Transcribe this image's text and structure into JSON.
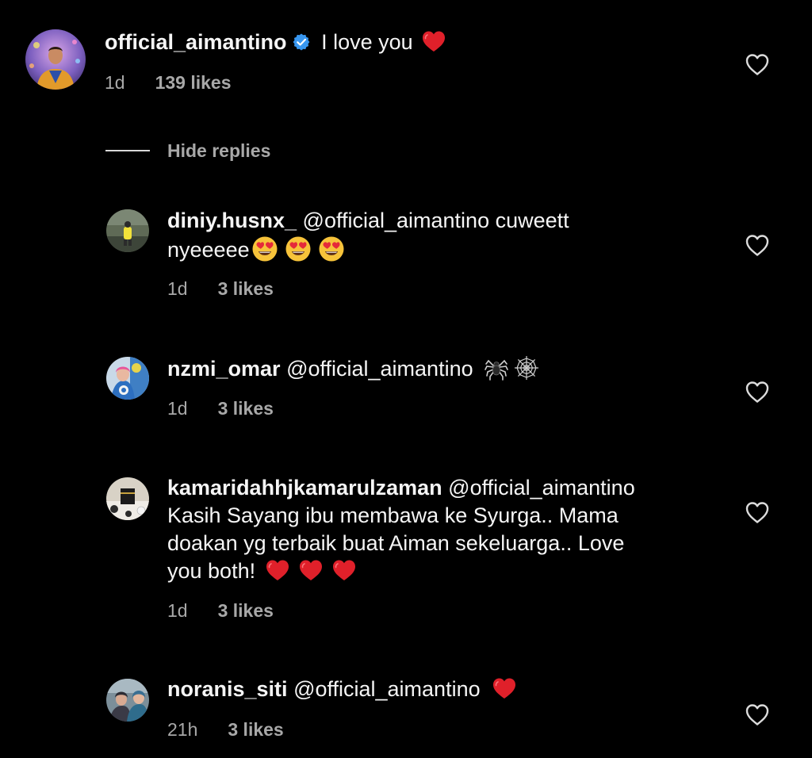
{
  "colors": {
    "background": "#000000",
    "text_primary": "#f5f5f5",
    "text_secondary": "#a8a8a8",
    "verified_blue": "#3897f0",
    "heart_red": "#e0202a"
  },
  "main_comment": {
    "username": "official_aimantino",
    "verified_icon": "verified-badge-icon",
    "text": "I love you",
    "emoji": "red-heart-emoji",
    "time": "1d",
    "likes": "139 likes",
    "like_icon": "heart-outline-icon"
  },
  "hide_replies": {
    "label": "Hide replies"
  },
  "replies": [
    {
      "username": "diniy.husnx_",
      "mention": "@official_aimantino",
      "text_line1": "cuweett",
      "text_line2": "nyeeeee",
      "emoji": "heart-eyes-emoji",
      "time": "1d",
      "likes": "3 likes"
    },
    {
      "username": "nzmi_omar",
      "mention": "@official_aimantino",
      "emoji": "spider-and-web-emoji",
      "time": "1d",
      "likes": "3 likes"
    },
    {
      "username": "kamaridahhjkamarulzaman",
      "mention": "@official_aimantino",
      "text_line1": "Kasih Sayang ibu membawa ke Syurga.. Mama",
      "text_line2": "doakan yg terbaik buat Aiman sekeluarga.. Love",
      "text_line3": "you both!",
      "emoji": "red-heart-emoji",
      "time": "1d",
      "likes": "3 likes"
    },
    {
      "username": "noranis_siti",
      "mention": "@official_aimantino",
      "emoji": "red-heart-emoji",
      "time": "21h",
      "likes": "3 likes"
    }
  ]
}
